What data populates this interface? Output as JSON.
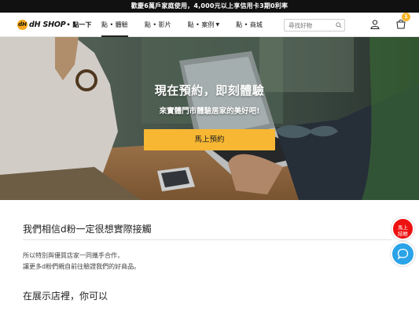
{
  "promo_bar": {
    "text": "歡慶6萬戶家庭使用，4,000元以上享信用卡3期0利率"
  },
  "header": {
    "logo_mark": "dH",
    "logo_text": "dH SHOP",
    "logo_sub": "• 點一下",
    "menu": [
      {
        "label": "點 • 體驗",
        "active": true
      },
      {
        "label": "點 • 影片",
        "active": false
      },
      {
        "label": "點 • 案例",
        "active": false,
        "dropdown": true
      },
      {
        "label": "點 • 商城",
        "active": false
      }
    ],
    "search_placeholder": "尋找好物",
    "cart_count": "1",
    "icons": {
      "search": "search-icon",
      "user": "user-icon",
      "cart": "cart-icon"
    }
  },
  "hero": {
    "title": "現在預約，即刻體驗",
    "subtitle": "來實體門市體驗居家的美好吧!",
    "cta": "馬上預約",
    "cta_color": "#f7b733"
  },
  "content": {
    "section1_title": "我們相信d粉一定很想實際接觸",
    "para_line1": "所以特別與優質店家一同攜手合作，",
    "para_line2": "讓更多d粉們親自前往驗證我們的好商品。",
    "section2_title": "在展示店裡，你可以"
  },
  "floating": {
    "reserve_line1": "馬上",
    "reserve_line2": "結帳",
    "reserve_color": "#e11111",
    "chat_icon": "chat-bubble-icon",
    "chat_color": "#2aa3e8"
  }
}
